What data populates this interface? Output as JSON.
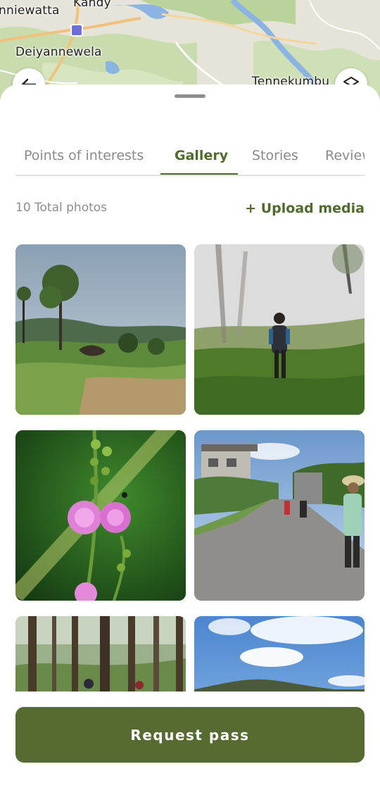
{
  "map": {
    "labels": {
      "nniewatta": "nniewatta",
      "kandy": "Kandy",
      "deiyannewela": "Deiyannewela",
      "tennekumbu": "Tennekumbu"
    },
    "icons": {
      "back": "arrow-left-icon",
      "layers": "layers-icon",
      "transit": "transit-station-icon"
    }
  },
  "tabs": [
    {
      "label": "Points of interests",
      "active": false
    },
    {
      "label": "Gallery",
      "active": true
    },
    {
      "label": "Stories",
      "active": false
    },
    {
      "label": "Reviews",
      "active": false
    }
  ],
  "gallery": {
    "total_photos": "10 Total photos",
    "upload_label": "+ Upload media",
    "photos": [
      {
        "subject": "hillside meadow with tall trees and cloudy sky"
      },
      {
        "subject": "hiker with backpack walking into misty forest"
      },
      {
        "subject": "pink mimosa flower close-up"
      },
      {
        "subject": "people walking along a village road"
      },
      {
        "subject": "pine forest with hikers"
      },
      {
        "subject": "blue sky with clouds over green hills"
      }
    ]
  },
  "footer": {
    "request_label": "Request pass"
  },
  "colors": {
    "accent": "#4f6b2c",
    "button": "#556b2f",
    "tab_inactive": "#8a8a8a",
    "muted_text": "#8d8d8d"
  }
}
